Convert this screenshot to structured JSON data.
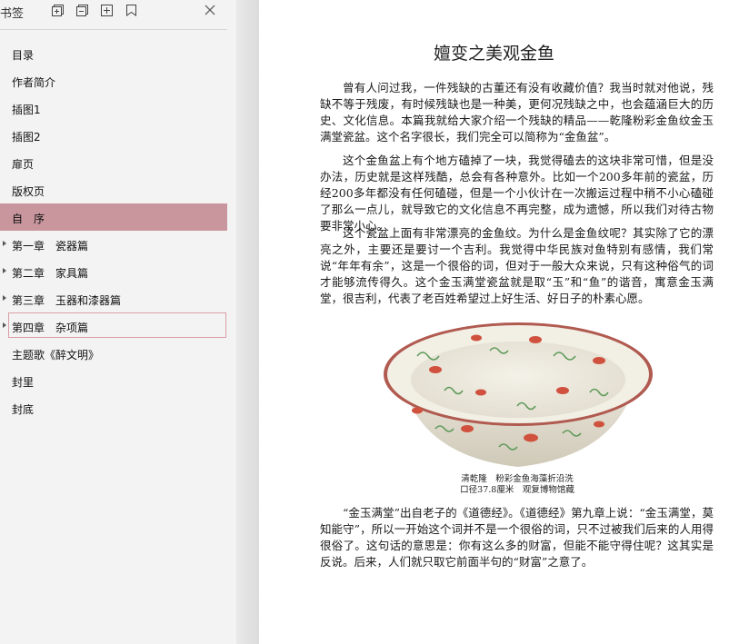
{
  "sidebar": {
    "title": "书签",
    "toolbar_icons": [
      "expand-all-icon",
      "collapse-all-icon",
      "add-bookmark-icon",
      "bookmark-icon"
    ],
    "items": [
      {
        "label": "目录",
        "expandable": false
      },
      {
        "label": "作者简介",
        "expandable": false
      },
      {
        "label": "插图1",
        "expandable": false
      },
      {
        "label": "插图2",
        "expandable": false
      },
      {
        "label": "扉页",
        "expandable": false
      },
      {
        "label": "版权页",
        "expandable": false
      },
      {
        "label": "自　序",
        "expandable": false,
        "state": "selected"
      },
      {
        "label": "第一章　瓷器篇",
        "expandable": true
      },
      {
        "label": "第二章　家具篇",
        "expandable": true
      },
      {
        "label": "第三章　玉器和漆器篇",
        "expandable": true
      },
      {
        "label": "第四章　杂项篇",
        "expandable": true,
        "state": "hovered"
      },
      {
        "label": "主题歌《醉文明》",
        "expandable": false
      },
      {
        "label": "封里",
        "expandable": false
      },
      {
        "label": "封底",
        "expandable": false
      }
    ],
    "selected_color": "#c8969c"
  },
  "document": {
    "title": "嬗变之美观金鱼",
    "paragraphs": [
      "曾有人问过我，一件残缺的古董还有没有收藏价值？我当时就对他说，残缺不等于残废，有时候残缺也是一种美，更何况残缺之中，也会蕴涵巨大的历史、文化信息。本篇我就给大家介绍一个残缺的精品——乾隆粉彩金鱼纹金玉满堂瓷盆。这个名字很长，我们完全可以简称为“金鱼盆”。",
      "这个金鱼盆上有个地方磕掉了一块，我觉得磕去的这块非常可惜，但是没办法，历史就是这样残酷，总会有各种意外。比如一个200多年前的瓷盆，历经200多年都没有任何磕碰，但是一个小伙计在一次搬运过程中稍不小心磕碰了那么一点儿，就导致它的文化信息不再完整，成为遗憾，所以我们对待古物要非常小心。",
      "这个瓷盆上面有非常漂亮的金鱼纹。为什么是金鱼纹呢？其实除了它的漂亮之外，主要还是要讨一个吉利。我觉得中华民族对鱼特别有感情，我们常说“年年有余”，这是一个很俗的词，但对于一般大众来说，只有这种俗气的词才能够流传得久。这个金玉满堂瓷盆就是取“玉”和“鱼”的谐音，寓意金玉满堂，很吉利，代表了老百姓希望过上好生活、好日子的朴素心愿。",
      "“金玉满堂”出自老子的《道德经》。《道德经》第九章上说：“金玉满堂，莫知能守”，所以一开始这个词并不是一个很俗的词，只不过被我们后来的人用得很俗了。这句话的意思是：你有这么多的财富，但能不能守得住呢？这其实是反说。后来，人们就只取它前面半句的“财富”之意了。"
    ],
    "figure": {
      "caption_line1": "清乾隆　粉彩金鱼海藻折沿洗",
      "caption_line2": "口径37.8厘米　观复博物馆藏"
    }
  }
}
